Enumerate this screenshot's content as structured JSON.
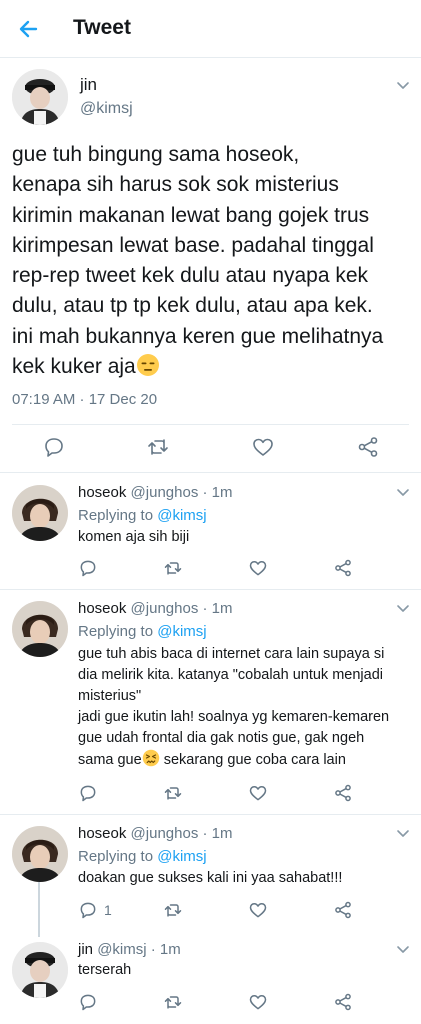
{
  "header": {
    "title": "Tweet",
    "back_icon": "arrow-left-icon",
    "accent": "#1da1f2"
  },
  "main_tweet": {
    "name": "jin",
    "handle": "@kimsj",
    "text_lines": [
      "gue tuh bingung sama hoseok,",
      "kenapa sih harus sok sok misterius",
      "kirimin makanan lewat bang gojek trus",
      "kirimpesan lewat base. padahal tinggal",
      "rep-rep tweet kek dulu atau nyapa kek",
      "dulu, atau tp tp kek dulu, atau apa kek.",
      "ini mah bukannya keren gue melihatnya",
      "kek kuker aja"
    ],
    "emoji": "expressionless-face-emoji",
    "timestamp": "07:19 AM · 17 Dec 20"
  },
  "replies": [
    {
      "name": "hoseok",
      "meta": "@junghos · 1m",
      "replying_label": "Replying to ",
      "replying_to": "@kimsj",
      "text_lines": [
        "komen aja sih biji"
      ]
    },
    {
      "name": "hoseok",
      "meta": "@junghos · 1m",
      "replying_label": "Replying to ",
      "replying_to": "@kimsj",
      "text_lines": [
        "gue tuh abis baca di internet cara lain supaya si",
        "dia melirik kita. katanya \"cobalah untuk menjadi",
        "misterius\"",
        "jadi gue ikutin lah! soalnya yg kemaren-kemaren",
        "gue udah frontal dia gak notis gue, gak ngeh",
        "sama gue",
        " sekarang gue coba cara lain"
      ],
      "emoji": "confounded-face-emoji"
    },
    {
      "name": "hoseok",
      "meta": "@junghos · 1m",
      "replying_label": "Replying to ",
      "replying_to": "@kimsj",
      "text_lines": [
        "doakan gue sukses kali ini yaa sahabat!!!"
      ],
      "reply_count": "1"
    },
    {
      "name": "jin",
      "meta": "@kimsj · 1m",
      "text_lines": [
        "terserah"
      ]
    }
  ],
  "icons": {
    "reply": "reply-icon",
    "retweet": "retweet-icon",
    "like": "heart-icon",
    "share": "share-icon",
    "more": "chevron-down-icon"
  },
  "colors": {
    "text": "#14171a",
    "secondary": "#657786",
    "link": "#1da1f2",
    "divider": "#e6ecf0"
  }
}
